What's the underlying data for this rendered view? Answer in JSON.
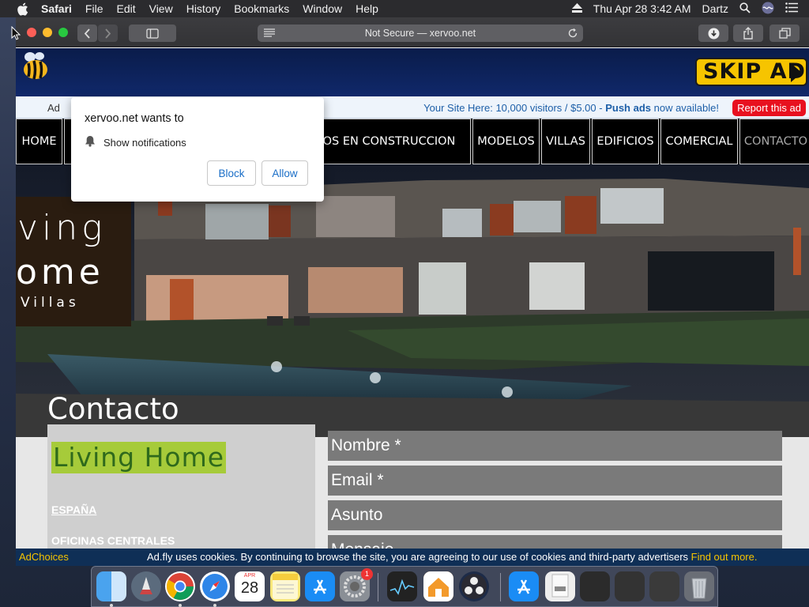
{
  "menubar": {
    "app": "Safari",
    "items": [
      "File",
      "Edit",
      "View",
      "History",
      "Bookmarks",
      "Window",
      "Help"
    ],
    "clock": "Thu Apr 28  3:42 AM",
    "user": "Dartz"
  },
  "browser": {
    "address": "Not Secure — xervoo.net"
  },
  "ads": {
    "skip_ad": "SKIP AD",
    "left_text": "Ad",
    "message_prefix": "Your Site Here: 10,000 visitors / $5.00 - ",
    "message_bold": "Push ads",
    "message_suffix": " now available!",
    "report": "Report this ad"
  },
  "nav": {
    "items": [
      "HOME",
      "",
      "",
      "YECTOS EN CONSTRUCCION",
      "MODELOS",
      "VILLAS",
      "EDIFICIOS",
      "COMERCIAL",
      "CONTACTO"
    ]
  },
  "hero": {
    "logo_line1": "ving",
    "logo_line2": "ome",
    "logo_line3": "Villas",
    "title": "Contacto"
  },
  "content": {
    "brand": "Living Home",
    "country": "ESPAÑA",
    "offices": "OFICINAS CENTRALES",
    "form": {
      "name_placeholder": "Nombre *",
      "email_placeholder": "Email *",
      "subject_placeholder": "Asunto",
      "message_placeholder": "Mensaje"
    }
  },
  "notification": {
    "title": "xervoo.net wants to",
    "permission": "Show notifications",
    "block": "Block",
    "allow": "Allow"
  },
  "cookie": {
    "choices": "AdChoices",
    "message": "Ad.fly uses cookies. By continuing to browse the site, you are agreeing to our use of cookies and third-party advertisers ",
    "more": "Find out more."
  },
  "dock": {
    "calendar_month": "APR",
    "calendar_day": "28",
    "badge": "1"
  }
}
